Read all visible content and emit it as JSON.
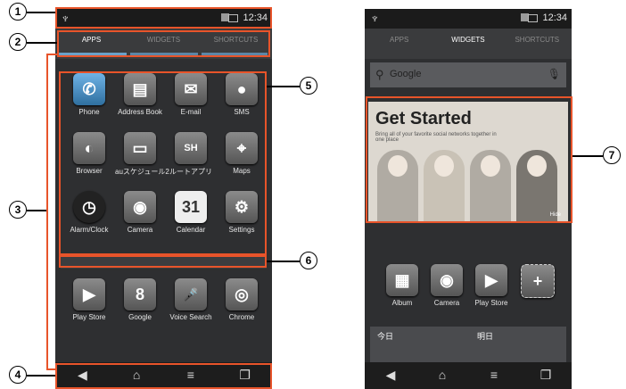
{
  "status": {
    "carrier_icon": "antenna-icon",
    "time": "12:34"
  },
  "tabs": [
    "APPS",
    "WIDGETS",
    "SHORTCUTS"
  ],
  "apps": [
    {
      "label": "Phone",
      "glyph": "✆"
    },
    {
      "label": "Address Book",
      "glyph": "▤"
    },
    {
      "label": "E-mail",
      "glyph": "✉"
    },
    {
      "label": "SMS",
      "glyph": "●"
    },
    {
      "label": "Browser",
      "glyph": "◐"
    },
    {
      "label": "auスケジュール2",
      "glyph": "▭"
    },
    {
      "label": "ルートアプリ",
      "glyph": "SH"
    },
    {
      "label": "Maps",
      "glyph": "⌖"
    },
    {
      "label": "Alarm/Clock",
      "glyph": "◷"
    },
    {
      "label": "Camera",
      "glyph": "◉"
    },
    {
      "label": "Calendar",
      "glyph": "31"
    },
    {
      "label": "Settings",
      "glyph": "⚙"
    },
    {
      "label": "Play Store",
      "glyph": "▶"
    },
    {
      "label": "Google",
      "glyph": "8"
    },
    {
      "label": "Voice Search",
      "glyph": "🎤"
    },
    {
      "label": "Chrome",
      "glyph": "◎"
    }
  ],
  "widgets": {
    "search_placeholder": "Google",
    "banner_title": "Get Started",
    "banner_subtitle": "Bring all of your favorite social networks together in one place",
    "banner_hide": "Hide",
    "dock": [
      "Album",
      "Camera",
      "Play Store"
    ],
    "weather": {
      "today": "今日",
      "tomorrow": "明日"
    }
  },
  "callouts": [
    "1",
    "2",
    "3",
    "4",
    "5",
    "6",
    "7"
  ],
  "colors": {
    "highlight": "#e8542a",
    "accent": "#5c86a6"
  }
}
